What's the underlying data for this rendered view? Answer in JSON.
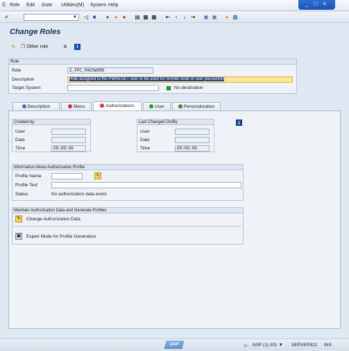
{
  "menubar": {
    "items": [
      "Role",
      "Edit",
      "Goto",
      "Utilities(M)",
      "System",
      "Help"
    ],
    "window_controls": "_ □ ×"
  },
  "title": "Change Roles",
  "app_toolbar": {
    "other_role": "Other role"
  },
  "role_group": {
    "header": "Role",
    "role_label": "Role",
    "role_value": "Z_FPC_PASSWORD",
    "description_label": "Description",
    "description_value": "Role assigned to the PWRESET user to be used for remote reset of user passwords",
    "target_label": "Target System",
    "target_value": "",
    "target_status": "No destination"
  },
  "tabs": [
    {
      "label": "Description",
      "color": "#4a73b8"
    },
    {
      "label": "Menu",
      "color": "#d23a3a"
    },
    {
      "label": "Authorizations",
      "color": "#d23a3a"
    },
    {
      "label": "User",
      "color": "#2aa52a"
    },
    {
      "label": "Personalization",
      "color": "#7a6a3a"
    }
  ],
  "created": {
    "header": "Created by",
    "user_label": "User",
    "date_label": "Date",
    "time_label": "Time",
    "user": "",
    "date": "",
    "time": "00:00:00"
  },
  "changed": {
    "header": "Last Changed On/By",
    "user_label": "User",
    "date_label": "Date",
    "time_label": "Time",
    "user": "",
    "date": "",
    "time": "00:00:00"
  },
  "profile_info": {
    "header": "Information About Authorization Profile",
    "name_label": "Profile Name",
    "name_value": "",
    "text_label": "Profile Text",
    "text_value": "",
    "status_label": "Status",
    "status_value": "No authorization data exists"
  },
  "maintain": {
    "header": "Maintain Authorization Data and Generate Profiles",
    "change_label": "Change Authorization Data",
    "expert_label": "Expert Mode for Profile Generation"
  },
  "statusbar": {
    "logo": "SAP",
    "system": "NSP (1) 001",
    "server": "SERVER921",
    "mode": "INS"
  }
}
